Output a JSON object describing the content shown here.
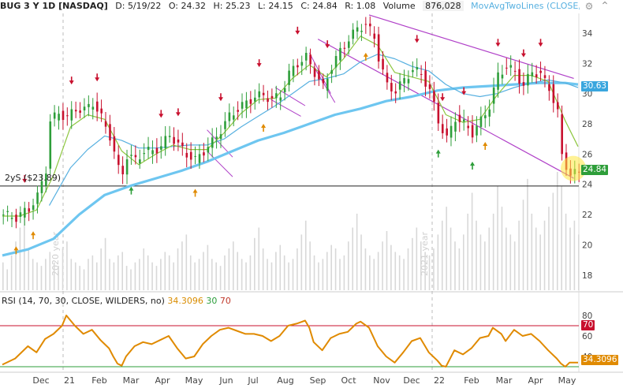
{
  "header": {
    "symbol": "BUG 3 Y 1D [NASDAQ]",
    "date": "D: 5/19/22",
    "open": "O: 24.32",
    "high": "H: 25.23",
    "low": "L: 24.15",
    "close": "C: 24.84",
    "range": "R: 1.08",
    "volume_label": "Volume",
    "volume_value": "876,028",
    "ma_study": "MovAvgTwoLines (CLOSE, 50, 100, 0,..."
  },
  "rsi_header": {
    "study": "RSI (14, 70, 30, CLOSE, WILDERS, no)",
    "value": "34.3096",
    "low_level": "30",
    "high_level": "70"
  },
  "support_label": "2yS ($23.89)",
  "tags": {
    "ma_value": "30.63",
    "price_value": "24.84",
    "rsi_upper": "70",
    "rsi_value": "34.3096"
  },
  "watermarks": [
    "2020 year",
    "2021 year"
  ],
  "colors": {
    "up": "#2e9e3a",
    "down": "#c8102e",
    "ma_fast": "#8dc63f",
    "ma_mid": "#57b0e0",
    "ma_slow": "#6ec6f0",
    "channel": "#b040c8",
    "rsi": "#e08a00",
    "rsi_upper_line": "#c8102e",
    "rsi_lower_line": "#2e9e3a"
  },
  "chart_data": {
    "type": "candlestick",
    "price_axis": {
      "min": 17,
      "max": 35.3,
      "ticks": [
        18,
        20,
        22,
        24,
        26,
        28,
        30,
        32,
        34
      ]
    },
    "rsi_axis": {
      "ticks": [
        40,
        60,
        80
      ],
      "overbought": 70,
      "oversold": 30
    },
    "x_axis_labels": [
      "Dec",
      "21",
      "Feb",
      "Mar",
      "Apr",
      "May",
      "Jun",
      "Jul",
      "Aug",
      "Sep",
      "Oct",
      "Nov",
      "Dec",
      "22",
      "Feb",
      "Mar",
      "Apr",
      "May"
    ],
    "support_level": 23.89,
    "last_close": 24.84,
    "close_series": [
      [
        0,
        22.0
      ],
      [
        3,
        21.8
      ],
      [
        6,
        22.4
      ],
      [
        8,
        23.2
      ],
      [
        10,
        25.0
      ],
      [
        11,
        28.2
      ],
      [
        13,
        28.7
      ],
      [
        15,
        28.4
      ],
      [
        17,
        29.0
      ],
      [
        19,
        28.9
      ],
      [
        21,
        29.4
      ],
      [
        23,
        28.4
      ],
      [
        25,
        27.2
      ],
      [
        27,
        25.0
      ],
      [
        28,
        24.8
      ],
      [
        29,
        25.9
      ],
      [
        31,
        25.6
      ],
      [
        33,
        26.2
      ],
      [
        35,
        26.2
      ],
      [
        37,
        26.5
      ],
      [
        39,
        27.3
      ],
      [
        41,
        26.6
      ],
      [
        43,
        26.0
      ],
      [
        45,
        25.6
      ],
      [
        47,
        26.2
      ],
      [
        49,
        26.8
      ],
      [
        51,
        27.6
      ],
      [
        53,
        28.5
      ],
      [
        55,
        29.0
      ],
      [
        57,
        29.4
      ],
      [
        59,
        29.8
      ],
      [
        61,
        29.9
      ],
      [
        63,
        29.6
      ],
      [
        65,
        29.9
      ],
      [
        67,
        31.3
      ],
      [
        69,
        32.0
      ],
      [
        71,
        32.4
      ],
      [
        73,
        31.4
      ],
      [
        75,
        30.4
      ],
      [
        77,
        31.8
      ],
      [
        79,
        32.8
      ],
      [
        81,
        33.6
      ],
      [
        83,
        34.3
      ],
      [
        85,
        34.6
      ],
      [
        87,
        33.7
      ],
      [
        88,
        32.4
      ],
      [
        90,
        30.5
      ],
      [
        92,
        30.2
      ],
      [
        94,
        30.9
      ],
      [
        96,
        31.6
      ],
      [
        98,
        31.3
      ],
      [
        100,
        30.2
      ],
      [
        102,
        28.2
      ],
      [
        104,
        27.0
      ],
      [
        106,
        28.4
      ],
      [
        108,
        28.0
      ],
      [
        110,
        27.4
      ],
      [
        112,
        28.2
      ],
      [
        114,
        29.2
      ],
      [
        116,
        31.2
      ],
      [
        118,
        31.8
      ],
      [
        120,
        31.4
      ],
      [
        122,
        30.5
      ],
      [
        124,
        31.5
      ],
      [
        126,
        31.2
      ],
      [
        128,
        30.4
      ],
      [
        130,
        28.7
      ],
      [
        131,
        25.9
      ],
      [
        133,
        24.6
      ],
      [
        135,
        24.84
      ]
    ],
    "ma_fast": [
      [
        0,
        21.9
      ],
      [
        4,
        21.9
      ],
      [
        8,
        22.3
      ],
      [
        12,
        24.6
      ],
      [
        16,
        27.8
      ],
      [
        20,
        28.6
      ],
      [
        24,
        28.3
      ],
      [
        28,
        26.2
      ],
      [
        32,
        25.3
      ],
      [
        36,
        26.0
      ],
      [
        40,
        26.6
      ],
      [
        44,
        26.3
      ],
      [
        48,
        26.3
      ],
      [
        52,
        27.4
      ],
      [
        56,
        28.7
      ],
      [
        60,
        29.6
      ],
      [
        64,
        29.7
      ],
      [
        68,
        31.0
      ],
      [
        72,
        31.9
      ],
      [
        76,
        31.1
      ],
      [
        80,
        32.3
      ],
      [
        84,
        33.8
      ],
      [
        88,
        33.2
      ],
      [
        92,
        31.4
      ],
      [
        96,
        31.1
      ],
      [
        100,
        30.8
      ],
      [
        104,
        28.6
      ],
      [
        108,
        28.1
      ],
      [
        112,
        28.3
      ],
      [
        116,
        29.9
      ],
      [
        120,
        31.2
      ],
      [
        124,
        31.2
      ],
      [
        128,
        30.8
      ],
      [
        132,
        28.2
      ],
      [
        135,
        26.5
      ]
    ],
    "ma_mid": [
      [
        11,
        22.6
      ],
      [
        16,
        25.1
      ],
      [
        20,
        26.3
      ],
      [
        24,
        27.2
      ],
      [
        28,
        26.9
      ],
      [
        32,
        26.4
      ],
      [
        36,
        26.4
      ],
      [
        40,
        26.5
      ],
      [
        44,
        26.6
      ],
      [
        48,
        26.6
      ],
      [
        52,
        27.0
      ],
      [
        56,
        27.8
      ],
      [
        60,
        28.5
      ],
      [
        64,
        29.2
      ],
      [
        68,
        30.0
      ],
      [
        72,
        30.8
      ],
      [
        76,
        31.0
      ],
      [
        80,
        31.3
      ],
      [
        84,
        32.1
      ],
      [
        88,
        32.6
      ],
      [
        92,
        32.3
      ],
      [
        96,
        31.8
      ],
      [
        100,
        31.5
      ],
      [
        104,
        30.6
      ],
      [
        108,
        30.0
      ],
      [
        112,
        29.8
      ],
      [
        116,
        30.0
      ],
      [
        120,
        30.4
      ],
      [
        124,
        30.7
      ],
      [
        128,
        30.9
      ],
      [
        132,
        30.7
      ],
      [
        135,
        30.4
      ]
    ],
    "ma_slow": [
      [
        0,
        19.3
      ],
      [
        6,
        19.7
      ],
      [
        12,
        20.4
      ],
      [
        18,
        22.0
      ],
      [
        24,
        23.3
      ],
      [
        30,
        23.9
      ],
      [
        36,
        24.4
      ],
      [
        42,
        24.9
      ],
      [
        48,
        25.5
      ],
      [
        54,
        26.2
      ],
      [
        60,
        26.9
      ],
      [
        66,
        27.4
      ],
      [
        72,
        28.0
      ],
      [
        78,
        28.6
      ],
      [
        84,
        29.0
      ],
      [
        90,
        29.5
      ],
      [
        96,
        29.8
      ],
      [
        102,
        30.2
      ],
      [
        108,
        30.4
      ],
      [
        114,
        30.5
      ],
      [
        120,
        30.6
      ],
      [
        126,
        30.7
      ],
      [
        132,
        30.7
      ],
      [
        135,
        30.6
      ]
    ],
    "channel_upper": [
      [
        86,
        35.2
      ],
      [
        134,
        31.0
      ]
    ],
    "channel_lower": [
      [
        74,
        33.6
      ],
      [
        134,
        24.4
      ]
    ],
    "minor_channels": [
      [
        [
          48,
          27.6
        ],
        [
          54,
          25.8
        ]
      ],
      [
        [
          48,
          26.2
        ],
        [
          54,
          24.5
        ]
      ],
      [
        [
          64,
          30.4
        ],
        [
          71,
          29.2
        ]
      ],
      [
        [
          63,
          29.6
        ],
        [
          70,
          28.5
        ]
      ],
      [
        [
          73,
          31.8
        ],
        [
          78,
          29.4
        ]
      ],
      [
        [
          72,
          32.7
        ],
        [
          77,
          30.0
        ]
      ]
    ],
    "rsi_series": [
      [
        0,
        32
      ],
      [
        3,
        38
      ],
      [
        6,
        50
      ],
      [
        8,
        44
      ],
      [
        10,
        57
      ],
      [
        12,
        62
      ],
      [
        14,
        70
      ],
      [
        15,
        80
      ],
      [
        17,
        70
      ],
      [
        19,
        62
      ],
      [
        21,
        66
      ],
      [
        23,
        56
      ],
      [
        25,
        48
      ],
      [
        26,
        40
      ],
      [
        27,
        33
      ],
      [
        28,
        31
      ],
      [
        29,
        40
      ],
      [
        31,
        50
      ],
      [
        33,
        54
      ],
      [
        35,
        52
      ],
      [
        37,
        56
      ],
      [
        39,
        60
      ],
      [
        41,
        48
      ],
      [
        43,
        38
      ],
      [
        45,
        40
      ],
      [
        47,
        52
      ],
      [
        49,
        60
      ],
      [
        51,
        66
      ],
      [
        53,
        68
      ],
      [
        55,
        65
      ],
      [
        57,
        62
      ],
      [
        59,
        62
      ],
      [
        61,
        60
      ],
      [
        63,
        55
      ],
      [
        65,
        60
      ],
      [
        67,
        70
      ],
      [
        69,
        72
      ],
      [
        71,
        75
      ],
      [
        72,
        68
      ],
      [
        73,
        54
      ],
      [
        75,
        46
      ],
      [
        77,
        58
      ],
      [
        79,
        62
      ],
      [
        81,
        64
      ],
      [
        83,
        72
      ],
      [
        84,
        74
      ],
      [
        86,
        68
      ],
      [
        88,
        50
      ],
      [
        90,
        40
      ],
      [
        92,
        34
      ],
      [
        94,
        44
      ],
      [
        96,
        55
      ],
      [
        98,
        58
      ],
      [
        100,
        44
      ],
      [
        102,
        36
      ],
      [
        103,
        31
      ],
      [
        104,
        30
      ],
      [
        106,
        46
      ],
      [
        108,
        42
      ],
      [
        110,
        48
      ],
      [
        112,
        58
      ],
      [
        114,
        60
      ],
      [
        115,
        68
      ],
      [
        117,
        62
      ],
      [
        118,
        55
      ],
      [
        120,
        66
      ],
      [
        122,
        60
      ],
      [
        124,
        62
      ],
      [
        126,
        55
      ],
      [
        128,
        46
      ],
      [
        130,
        38
      ],
      [
        131,
        33
      ],
      [
        132,
        30
      ],
      [
        133,
        34
      ],
      [
        135,
        34
      ]
    ],
    "volume": [
      8,
      6,
      10,
      14,
      18,
      22,
      12,
      9,
      8,
      7,
      9,
      11,
      8,
      7,
      12,
      14,
      9,
      8,
      7,
      6,
      9,
      10,
      8,
      12,
      15,
      9,
      8,
      10,
      11,
      7,
      6,
      8,
      9,
      12,
      10,
      8,
      7,
      9,
      11,
      10,
      8,
      12,
      14,
      16,
      10,
      8,
      9,
      11,
      13,
      9,
      8,
      7,
      10,
      12,
      14,
      11,
      9,
      8,
      10,
      15,
      18,
      12,
      9,
      8,
      11,
      13,
      10,
      8,
      9,
      12,
      16,
      20,
      14,
      10,
      8,
      9,
      11,
      13,
      12,
      9,
      10,
      14,
      18,
      22,
      16,
      12,
      10,
      9,
      11,
      14,
      17,
      13,
      11,
      10,
      9,
      12,
      15,
      18,
      14,
      11,
      10,
      12,
      16,
      20,
      24,
      18,
      14,
      12,
      16,
      22,
      28,
      20,
      16,
      14,
      18,
      22,
      30,
      24,
      18,
      16,
      14,
      20,
      26,
      32,
      22,
      18,
      16,
      20,
      24,
      28,
      34,
      30,
      22,
      18,
      20,
      16
    ]
  }
}
